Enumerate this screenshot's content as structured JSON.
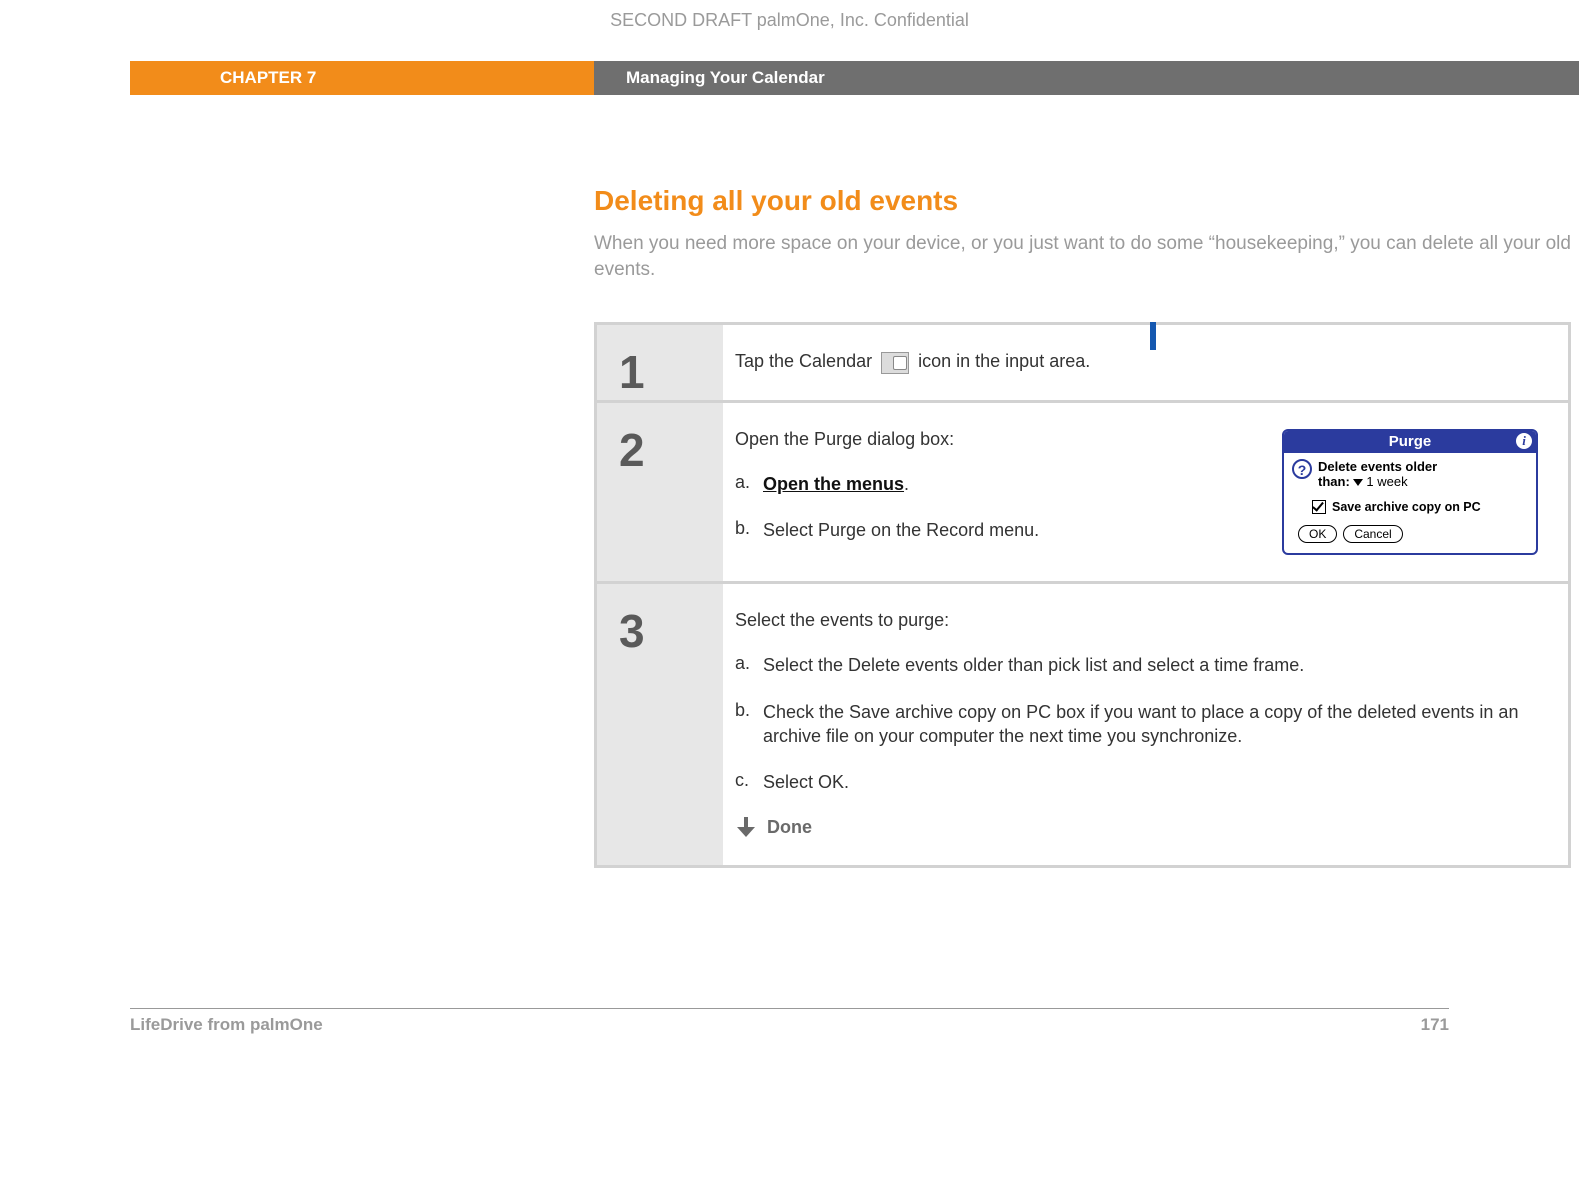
{
  "draft_line": "SECOND DRAFT palmOne, Inc.  Confidential",
  "banner": {
    "chapter": "CHAPTER 7",
    "title": "Managing Your Calendar"
  },
  "section": {
    "heading": "Deleting all your old events",
    "intro": "When you need more space on your device, or you just want to do some “housekeeping,” you can delete all your old events."
  },
  "steps": {
    "s1": {
      "num": "1",
      "pre": "Tap the Calendar ",
      "post": " icon in the input area."
    },
    "s2": {
      "num": "2",
      "lead": "Open the Purge dialog box:",
      "a_letter": "a.",
      "a_text": "Open the menus",
      "a_suffix": ".",
      "b_letter": "b.",
      "b_text": "Select Purge on the Record menu."
    },
    "s3": {
      "num": "3",
      "lead": "Select the events to purge:",
      "a_letter": "a.",
      "a_text": "Select the Delete events older than pick list and select a time frame.",
      "b_letter": "b.",
      "b_text": "Check the Save archive copy on PC box if you want to place a copy of the deleted events in an archive file on your computer the next time you synchronize.",
      "c_letter": "c.",
      "c_text": "Select OK.",
      "done": "Done"
    }
  },
  "dialog": {
    "title": "Purge",
    "line1": "Delete events older",
    "line2_label": "than:",
    "pick_value": "1 week",
    "checkbox_label": "Save archive copy on PC",
    "ok": "OK",
    "cancel": "Cancel"
  },
  "footer": {
    "product": "LifeDrive from palmOne",
    "page": "171"
  }
}
